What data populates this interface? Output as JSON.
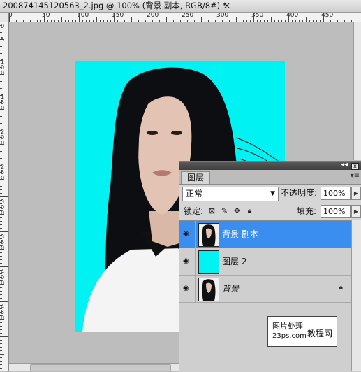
{
  "window": {
    "title": "200874145120563_2.jpg @ 100% (背景 副本, RGB/8#) *",
    "close_glyph": "×"
  },
  "ruler": {
    "top_labels": [
      "0",
      "50",
      "100",
      "150",
      "200",
      "250",
      "300",
      "350",
      "400",
      "450"
    ],
    "left_labels": [
      "0",
      "5",
      "1 0 0",
      "1 5 0",
      "2 0 0",
      "2 5 0",
      "3 0 0",
      "3 5 0",
      "4 0 0",
      "4 5 0"
    ]
  },
  "layers_panel": {
    "collapse_glyph": "◂◂",
    "close_glyph": "x",
    "tab_label": "图层",
    "menu_glyph": "▾≡",
    "blend_mode": "正常",
    "opacity_label": "不透明度:",
    "opacity_value": "100%",
    "lock_label": "锁定:",
    "fill_label": "填充:",
    "fill_value": "100%",
    "layers": [
      {
        "name": "背景 副本",
        "selected": true,
        "thumb": "photo"
      },
      {
        "name": "图层 2",
        "selected": false,
        "thumb": "cyan"
      },
      {
        "name": "背景",
        "selected": false,
        "thumb": "photo",
        "locked": true
      }
    ]
  },
  "watermark": {
    "line1": "图片处理",
    "line2": "23ps.com",
    "line3": "教程网"
  },
  "colors": {
    "canvas_bg": "#00f2f2",
    "selection": "#3a8ef0"
  }
}
